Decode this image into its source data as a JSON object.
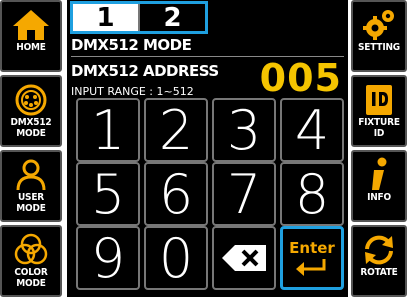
{
  "page_tabs": [
    {
      "label": "1",
      "active": true
    },
    {
      "label": "2",
      "active": false
    }
  ],
  "mode_title": "DMX512 MODE",
  "address": {
    "label": "DMX512 ADDRESS",
    "value": "005",
    "range_label": "INPUT RANGE : 1~512"
  },
  "left_menu": [
    {
      "label_lines": [
        "HOME"
      ],
      "icon": "home-icon"
    },
    {
      "label_lines": [
        "DMX512",
        "MODE"
      ],
      "icon": "xlr-connector-icon"
    },
    {
      "label_lines": [
        "USER",
        "MODE"
      ],
      "icon": "user-icon"
    },
    {
      "label_lines": [
        "COLOR",
        "MODE"
      ],
      "icon": "color-circles-icon"
    }
  ],
  "right_menu": [
    {
      "label_lines": [
        "SETTING"
      ],
      "icon": "gears-icon"
    },
    {
      "label_lines": [
        "FIXTURE",
        "ID"
      ],
      "icon": "id-card-icon"
    },
    {
      "label_lines": [
        "INFO"
      ],
      "icon": "info-icon"
    },
    {
      "label_lines": [
        "ROTATE"
      ],
      "icon": "rotate-icon"
    }
  ],
  "keypad": {
    "digits": [
      "1",
      "2",
      "3",
      "4",
      "5",
      "6",
      "7",
      "8",
      "9",
      "0"
    ],
    "enter_label": "Enter",
    "backspace_icon": "backspace-icon"
  },
  "colors": {
    "accent_blue": "#1fa0e0",
    "address_yellow": "#f5c400",
    "enter_orange": "#f5a800"
  }
}
